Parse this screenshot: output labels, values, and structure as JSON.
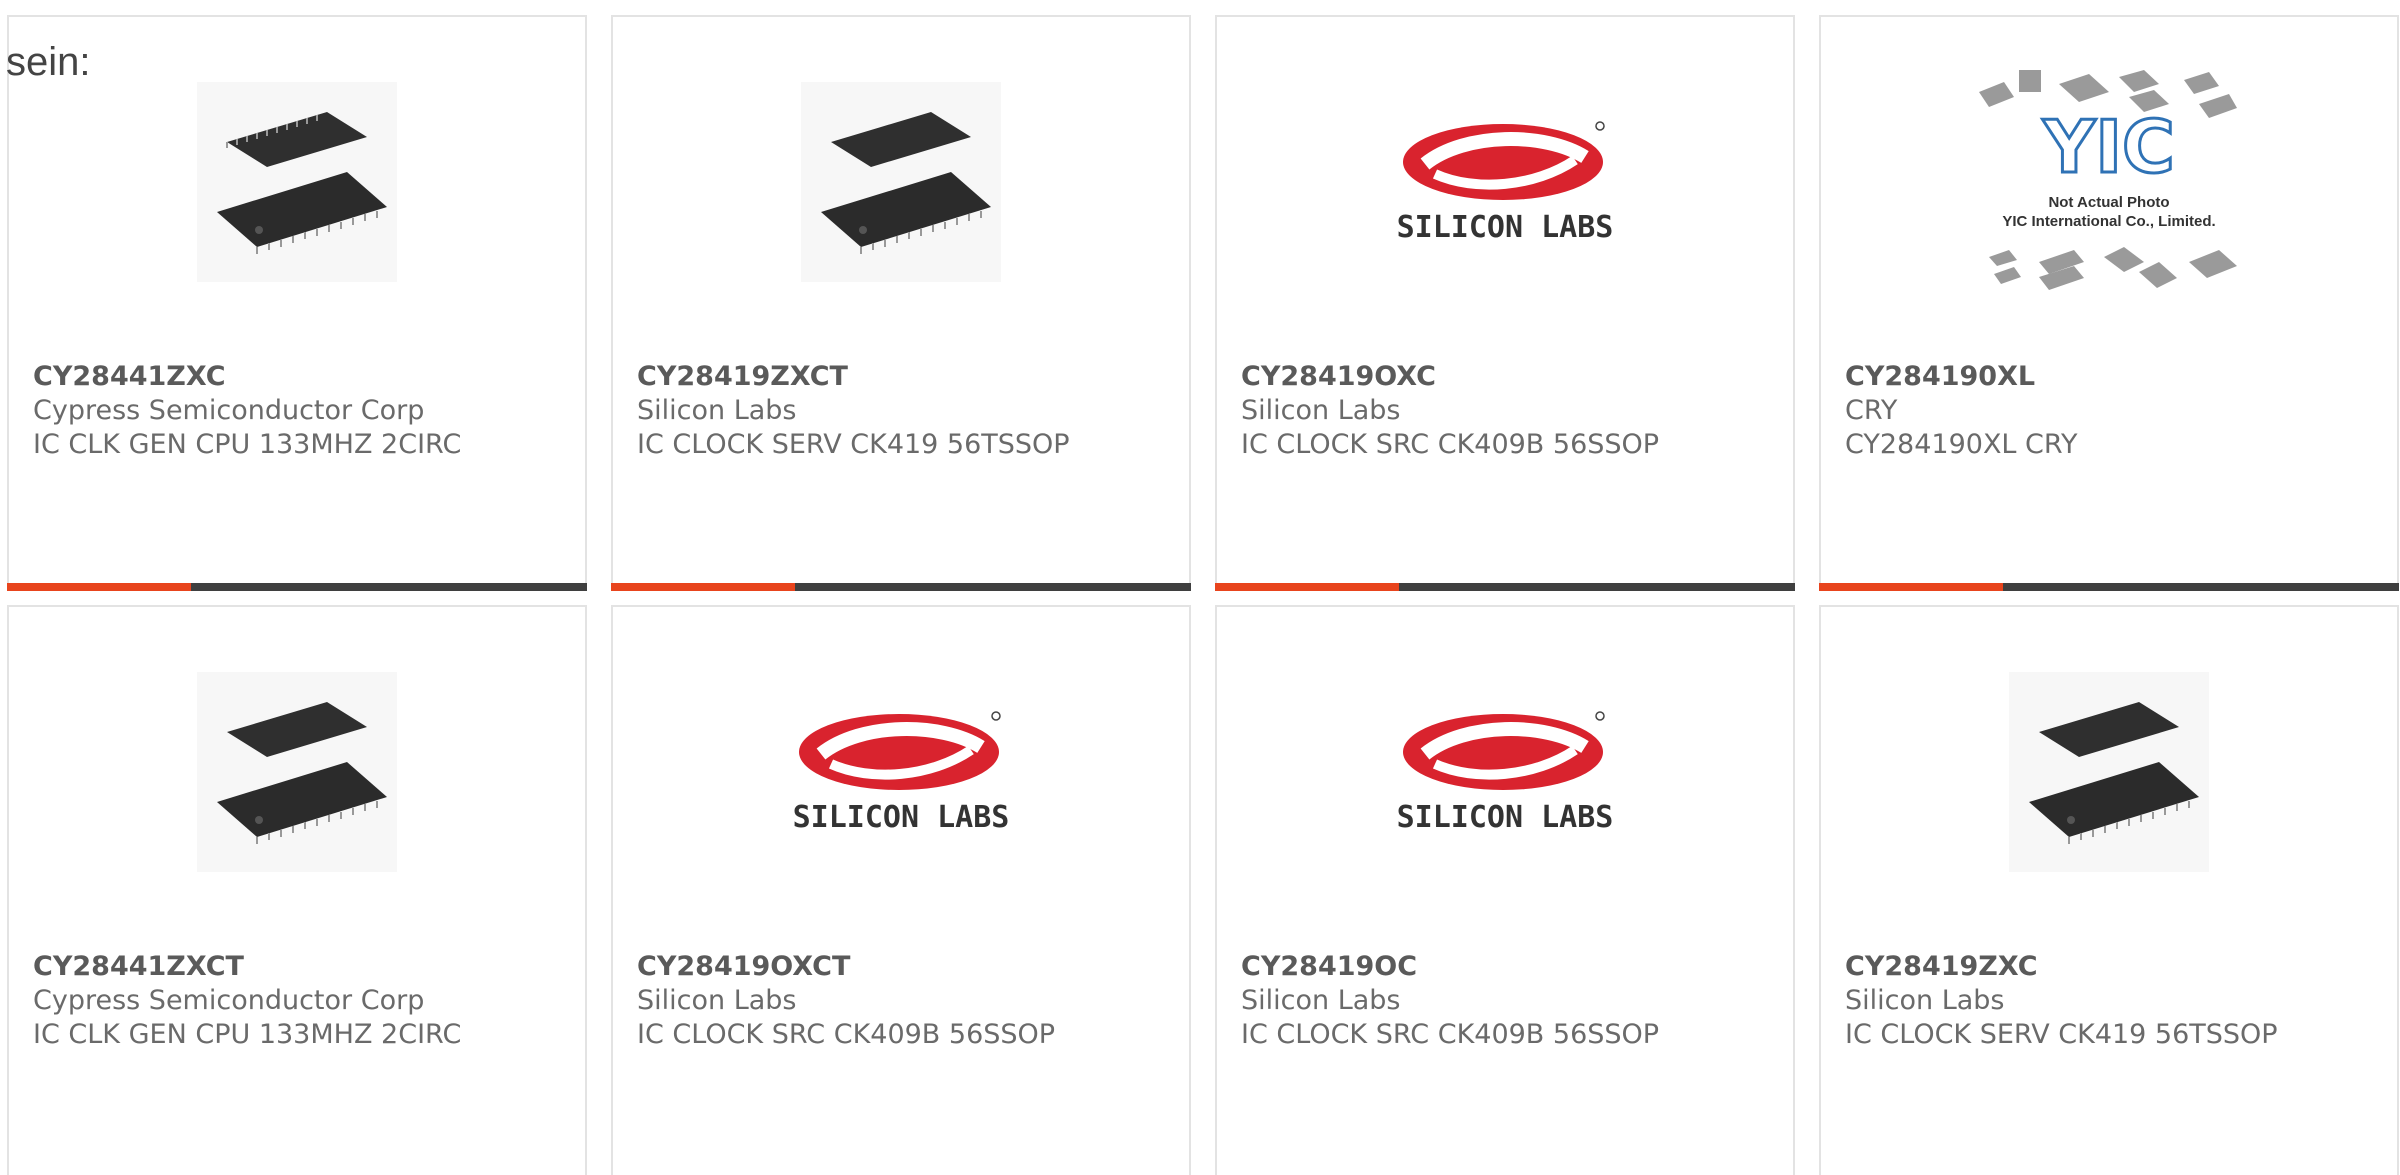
{
  "intro_text": "sein:",
  "colors": {
    "accent": "#e8441d",
    "bar": "#3f3f3f",
    "border": "#e3e3e3",
    "silicon_labs_red": "#d9232e"
  },
  "products": [
    {
      "part": "CY28441ZXC",
      "manufacturer": "Cypress Semiconductor Corp",
      "description": "IC CLK GEN CPU 133MHZ 2CIRC",
      "image": "chip-package-image"
    },
    {
      "part": "CY28419ZXCT",
      "manufacturer": "Silicon Labs",
      "description": "IC CLOCK SERV CK419 56TSSOP",
      "image": "chip-package-image"
    },
    {
      "part": "CY28419OXC",
      "manufacturer": "Silicon Labs",
      "description": "IC CLOCK SRC CK409B 56SSOP",
      "image": "silicon-labs-logo",
      "logo_text": "SILICON LABS"
    },
    {
      "part": "CY284190XL",
      "manufacturer": "CRY",
      "description": "CY284190XL CRY",
      "image": "yic-placeholder",
      "yic_lines": [
        "Not Actual Photo",
        "YIC International Co., Limited."
      ]
    },
    {
      "part": "CY28441ZXCT",
      "manufacturer": "Cypress Semiconductor Corp",
      "description": "IC CLK GEN CPU 133MHZ 2CIRC",
      "image": "chip-package-image"
    },
    {
      "part": "CY28419OXCT",
      "manufacturer": "Silicon Labs",
      "description": "IC CLOCK SRC CK409B 56SSOP",
      "image": "silicon-labs-logo",
      "logo_text": "SILICON LABS"
    },
    {
      "part": "CY28419OC",
      "manufacturer": "Silicon Labs",
      "description": "IC CLOCK SRC CK409B 56SSOP",
      "image": "silicon-labs-logo",
      "logo_text": "SILICON LABS"
    },
    {
      "part": "CY28419ZXC",
      "manufacturer": "Silicon Labs",
      "description": "IC CLOCK SERV CK419 56TSSOP",
      "image": "chip-package-image"
    }
  ]
}
